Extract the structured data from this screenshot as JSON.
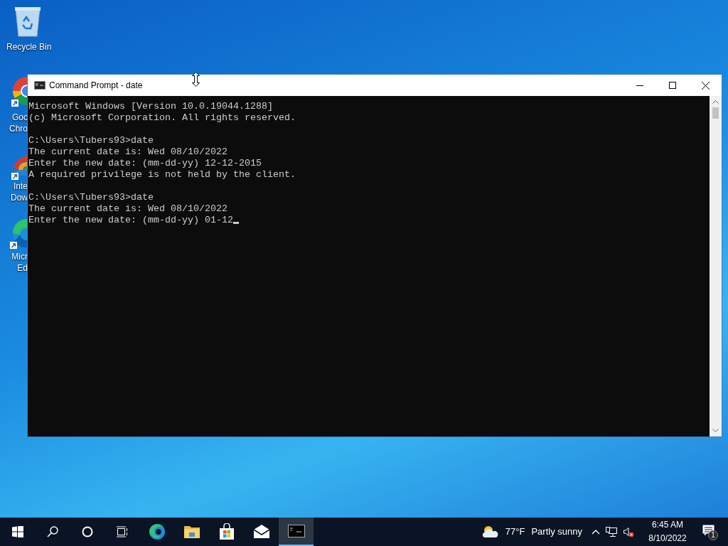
{
  "desktop_icons": [
    {
      "kind": "recycle",
      "label_lines": [
        "Recycle Bin"
      ]
    },
    {
      "kind": "chrome",
      "label_lines": [
        "Goc",
        "Chro"
      ]
    },
    {
      "kind": "idm",
      "label_lines": [
        "Inte",
        "Dow"
      ]
    },
    {
      "kind": "edge",
      "label_lines": [
        "Micr",
        "Ed"
      ]
    }
  ],
  "window": {
    "title": "Command Prompt - date",
    "console_blocks": [
      [
        "Microsoft Windows [Version 10.0.19044.1288]",
        "(c) Microsoft Corporation. All rights reserved."
      ],
      [
        "C:\\Users\\Tubers93>date",
        "The current date is: Wed 08/10/2022",
        "Enter the new date: (mm-dd-yy) 12-12-2015",
        "A required privilege is not held by the client."
      ],
      [
        "C:\\Users\\Tubers93>date",
        "The current date is: Wed 08/10/2022",
        "Enter the new date: (mm-dd-yy) 01-12"
      ]
    ]
  },
  "taskbar": {
    "items": [
      {
        "kind": "start",
        "selected": false
      },
      {
        "kind": "search",
        "selected": false
      },
      {
        "kind": "cortana",
        "selected": false
      },
      {
        "kind": "taskview",
        "selected": false
      },
      {
        "kind": "edge",
        "selected": false
      },
      {
        "kind": "folder",
        "selected": false
      },
      {
        "kind": "store",
        "selected": false
      },
      {
        "kind": "mail",
        "selected": false
      },
      {
        "kind": "terminal",
        "selected": true
      }
    ],
    "weather": {
      "temperature": "77°F",
      "condition": "Partly sunny"
    },
    "clock": {
      "time": "6:45 AM",
      "date": "8/10/2022"
    },
    "notifications": {
      "count": "1"
    }
  }
}
